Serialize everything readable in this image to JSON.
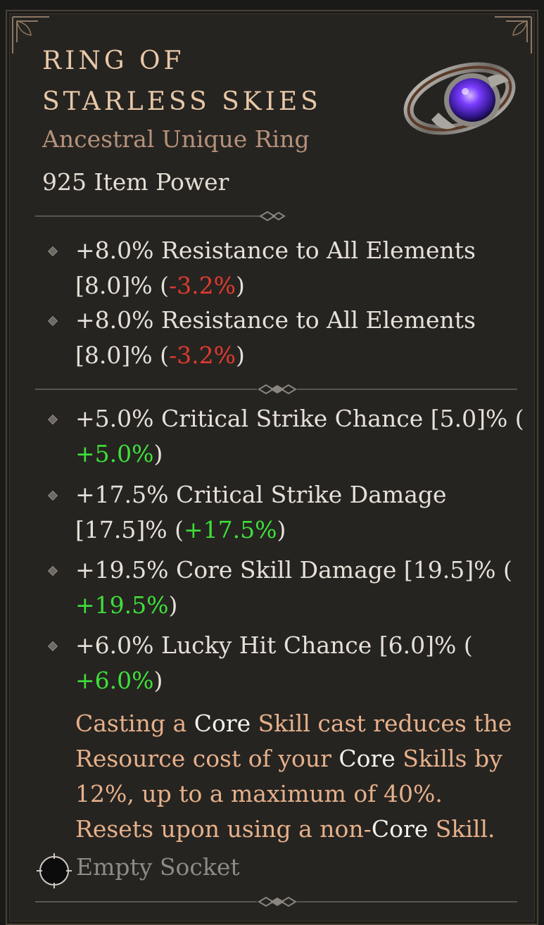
{
  "item": {
    "name_line1": "RING OF",
    "name_line2": "STARLESS SKIES",
    "type": "Ancestral Unique Ring",
    "item_power": "925 Item Power",
    "icon": "ring-icon"
  },
  "implicits": [
    {
      "line1": "+8.0% Resistance to All Elements",
      "line2_pre": "[8.0]% (",
      "delta": "-3.2%",
      "line2_post": ")"
    },
    {
      "line1": "+8.0% Resistance to All Elements",
      "line2_pre": "[8.0]% (",
      "delta": "-3.2%",
      "line2_post": ")"
    }
  ],
  "affixes": [
    {
      "line1": "+5.0% Critical Strike Chance [5.0]% (",
      "delta": "+5.0%",
      "line2_post": ")"
    },
    {
      "line1": "+17.5% Critical Strike Damage",
      "line2_pre": "[17.5]% (",
      "delta": "+17.5%",
      "line2_post": ")"
    },
    {
      "line1": "+19.5% Core Skill Damage [19.5]% (",
      "delta": "+19.5%",
      "line2_post": ")"
    },
    {
      "line1": "+6.0% Lucky Hit Chance [6.0]% (",
      "delta": "+6.0%",
      "line2_post": ")"
    }
  ],
  "aspect": {
    "l1a": "Casting a ",
    "l1k1": "Core",
    "l1b": " Skill cast reduces the",
    "l2a": "Resource cost of your ",
    "l2k": "Core",
    "l2b": " Skills by",
    "l3": "12%, up to a maximum of 40%.",
    "l4a": "Resets upon using a non-",
    "l4k": "Core",
    "l4b": " Skill."
  },
  "socket": {
    "label": "Empty Socket",
    "icon": "empty-socket-icon"
  },
  "colors": {
    "title": "#e8c8a8",
    "type": "#b5917a",
    "negative": "#e03a2e",
    "positive": "#3ee03a",
    "aspect": "#e6b08a",
    "keyword": "#f4f1ea"
  }
}
